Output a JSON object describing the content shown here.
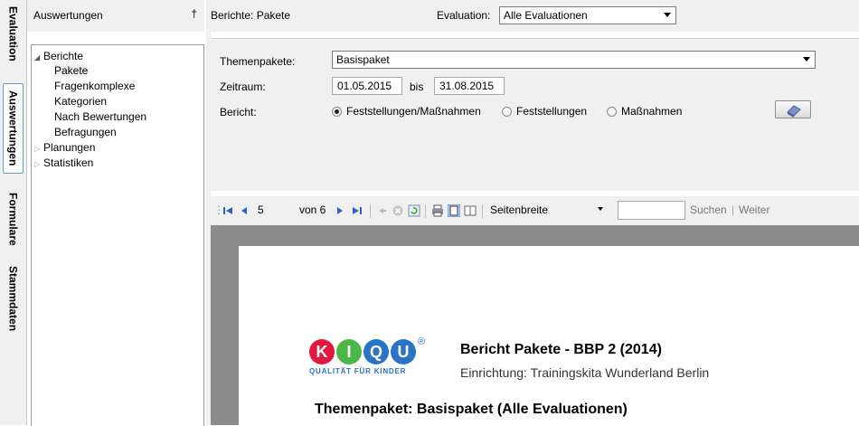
{
  "vertical_tabs": [
    {
      "label": "Evaluation",
      "active": false
    },
    {
      "label": "Auswertungen",
      "active": true
    },
    {
      "label": "Formulare",
      "active": false
    },
    {
      "label": "Stammdaten",
      "active": false
    }
  ],
  "left_panel": {
    "title": "Auswertungen",
    "pin_glyph": "†"
  },
  "tree": {
    "berichte": "Berichte",
    "pakete": "Pakete",
    "fragenkomplexe": "Fragenkomplexe",
    "kategorien": "Kategorien",
    "nach_bewertungen": "Nach Bewertungen",
    "befragungen": "Befragungen",
    "planungen": "Planungen",
    "statistiken": "Statistiken"
  },
  "header": {
    "title": "Berichte: Pakete",
    "evaluation_label": "Evaluation:",
    "evaluation_value": "Alle Evaluationen"
  },
  "params": {
    "themenpakete_label": "Themenpakete:",
    "themenpakete_value": "Basispaket",
    "zeitraum_label": "Zeitraum:",
    "date_from": "01.05.2015",
    "bis": "bis",
    "date_to": "31.08.2015",
    "bericht_label": "Bericht:",
    "options": [
      "Feststellungen/Maßnahmen",
      "Feststellungen",
      "Maßnahmen"
    ],
    "selected_option": 0
  },
  "toolbar": {
    "page": "5",
    "of_pages": "von 6",
    "zoom": "Seitenbreite",
    "search": "Suchen",
    "next": "Weiter",
    "search_value": ""
  },
  "report": {
    "logo_letters": [
      "K",
      "I",
      "Q",
      "U"
    ],
    "logo_colors": [
      "#e4173f",
      "#4bb748",
      "#2a73c5",
      "#2a73c5"
    ],
    "registered": "®",
    "logo_tagline": "QUALITÄT FÜR KINDER",
    "title": "Bericht Pakete - BBP 2 (2014)",
    "einrichtung": "Einrichtung: Trainingskita Wunderland Berlin",
    "section_heading": "Themenpaket: Basispaket (Alle Evaluationen)"
  }
}
